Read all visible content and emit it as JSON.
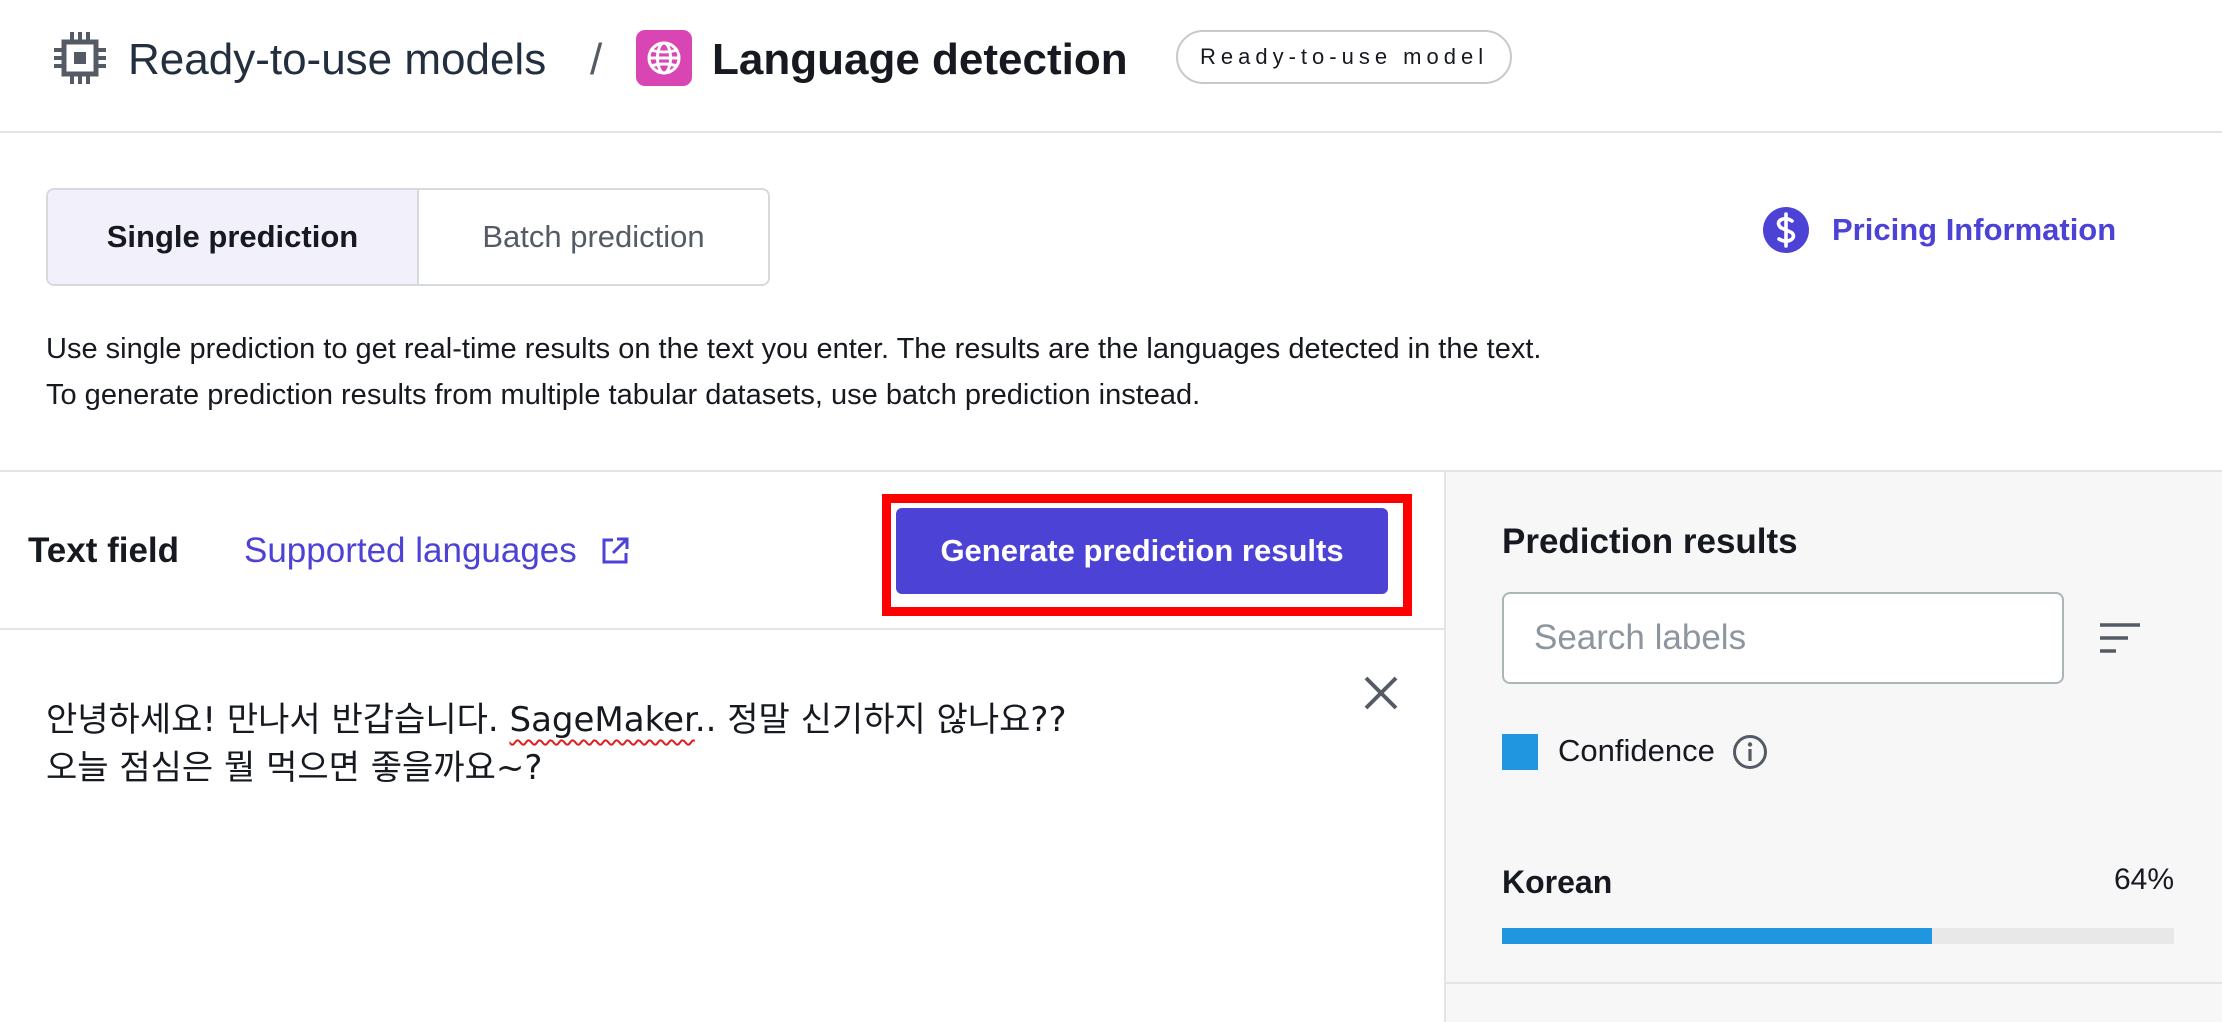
{
  "breadcrumb": {
    "root_label": "Ready-to-use models",
    "separator": "/",
    "current_label": "Language detection",
    "badge": "Ready-to-use model"
  },
  "tabs": {
    "single": "Single prediction",
    "batch": "Batch prediction",
    "active": "single"
  },
  "pricing": {
    "label": "Pricing Information"
  },
  "description": {
    "line1": "Use single prediction to get real-time results on the text you enter. The results are the languages detected in the text.",
    "line2": "To generate prediction results from multiple tabular datasets, use batch prediction instead."
  },
  "text_panel": {
    "label": "Text field",
    "supported_link": "Supported languages",
    "generate_button": "Generate prediction results",
    "text_part1": "안녕하세요! 만나서 반갑습니다. ",
    "text_misspelled": "SageMaker",
    "text_part2": ".. 정말 신기하지 않나요??\n오늘 점심은 뭘 먹으면 좋을까요~?"
  },
  "results": {
    "title": "Prediction results",
    "search_placeholder": "Search labels",
    "legend_label": "Confidence",
    "legend_color": "#2196e0",
    "items": [
      {
        "label": "Korean",
        "value_text": "64%",
        "value": 0.64
      }
    ]
  },
  "colors": {
    "accent": "#4d42d6",
    "highlight": "#ff0000",
    "app_icon_bg": "#d946b4"
  },
  "icons": [
    "chip-icon",
    "globe-icon",
    "dollar-icon",
    "external-link-icon",
    "close-icon",
    "sort-icon",
    "info-icon"
  ]
}
